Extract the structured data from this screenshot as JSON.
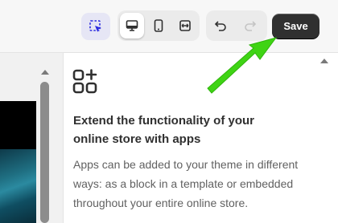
{
  "toolbar": {
    "icons": [
      "inspector-icon",
      "desktop-icon",
      "mobile-icon",
      "fullwidth-icon",
      "undo-icon",
      "redo-icon"
    ],
    "save_label": "Save",
    "accent_color": "#2c2ce0"
  },
  "panel": {
    "icon": "apps-icon",
    "title": "Extend the functionality of your online store with apps",
    "description": "Apps can be added to your theme in different ways: as a block in a template or embedded throughout your entire online store."
  },
  "annotation": {
    "icon": "green-arrow-icon",
    "color": "#3fd414"
  }
}
